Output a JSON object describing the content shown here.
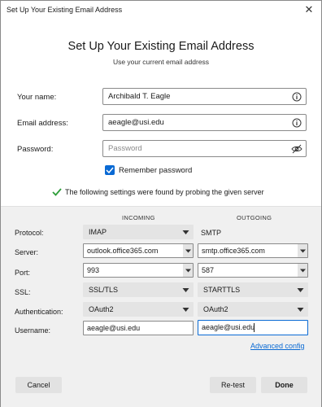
{
  "window": {
    "title": "Set Up Your Existing Email Address"
  },
  "header": {
    "title": "Set Up Your Existing Email Address",
    "subtitle": "Use your current email address"
  },
  "form": {
    "name_label": "Your name:",
    "name_value": "Archibald T. Eagle",
    "email_label": "Email address:",
    "email_value": "aeagle@usi.edu",
    "password_label": "Password:",
    "password_placeholder": "Password",
    "remember_label": "Remember password",
    "remember_checked": true
  },
  "status": {
    "message": "The following settings were found by probing the given server"
  },
  "server_settings": {
    "incoming_header": "INCOMING",
    "outgoing_header": "OUTGOING",
    "labels": {
      "protocol": "Protocol:",
      "server": "Server:",
      "port": "Port:",
      "ssl": "SSL:",
      "authentication": "Authentication:",
      "username": "Username:"
    },
    "incoming": {
      "protocol": "IMAP",
      "server": "outlook.office365.com",
      "port": "993",
      "ssl": "SSL/TLS",
      "authentication": "OAuth2",
      "username": "aeagle@usi.edu"
    },
    "outgoing": {
      "protocol": "SMTP",
      "server": "smtp.office365.com",
      "port": "587",
      "ssl": "STARTTLS",
      "authentication": "OAuth2",
      "username": "aeagle@usi.edu"
    },
    "advanced_link": "Advanced config"
  },
  "footer": {
    "cancel_label": "Cancel",
    "retest_label": "Re-test",
    "done_label": "Done"
  },
  "colors": {
    "accent": "#0a6ad4",
    "success": "#2e9e3a",
    "panel": "#f0f0f0"
  }
}
